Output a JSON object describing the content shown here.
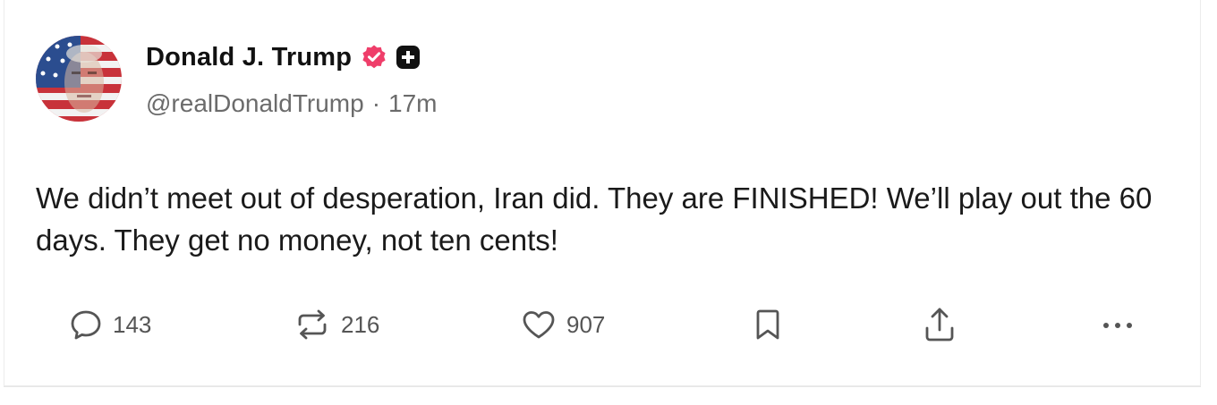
{
  "post": {
    "author_name": "Donald J. Trump",
    "handle": "@realDonaldTrump",
    "separator": "·",
    "time": "17m",
    "text": "We didn’t meet out of desperation, Iran did. They are FINISHED! We’ll play out the 60 days. They get no money, not ten cents!",
    "icons": {
      "avatar": "avatar-flag-portrait",
      "verified": "verified-badge-icon",
      "plus": "plus-badge-icon"
    },
    "colors": {
      "verified_badge": "#ef3e6a",
      "text": "#1a1a1a",
      "muted": "#6b6b6b"
    }
  },
  "actions": {
    "reply_count": "143",
    "repost_count": "216",
    "like_count": "907",
    "icons": [
      "reply-icon",
      "repost-icon",
      "like-icon",
      "bookmark-icon",
      "share-icon",
      "more-icon"
    ]
  }
}
